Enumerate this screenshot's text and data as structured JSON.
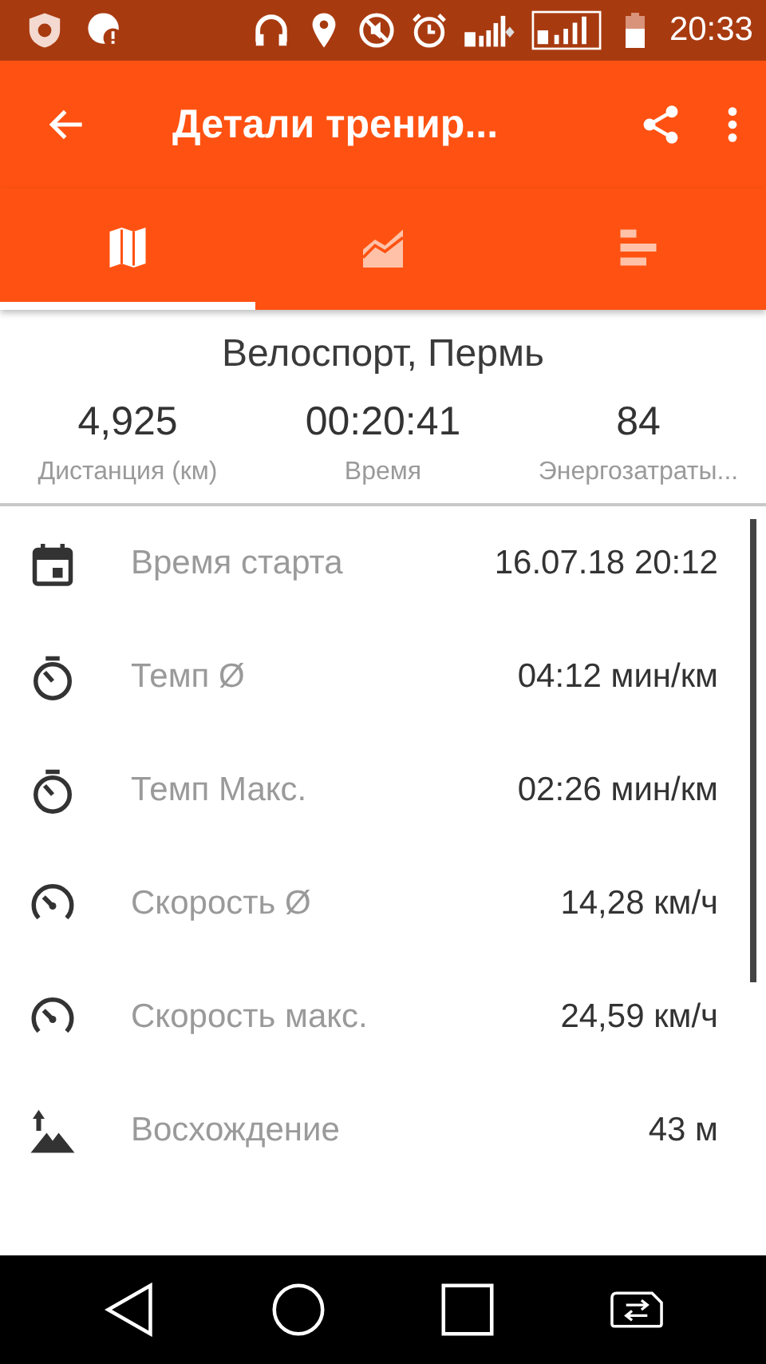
{
  "status_bar": {
    "time": "20:33"
  },
  "app_bar": {
    "title": "Детали тренир..."
  },
  "tabs": [
    {
      "kind": "map",
      "selected": true
    },
    {
      "kind": "chart",
      "selected": false
    },
    {
      "kind": "bars",
      "selected": false
    }
  ],
  "summary": {
    "title": "Велоспорт, Пермь",
    "stats": [
      {
        "value": "4,925",
        "label": "Дистанция (км)"
      },
      {
        "value": "00:20:41",
        "label": "Время"
      },
      {
        "value": "84",
        "label": "Энергозатраты..."
      }
    ]
  },
  "details": [
    {
      "kind": "calendar",
      "label": "Время старта",
      "value": "16.07.18 20:12"
    },
    {
      "kind": "timer",
      "label": "Темп Ø",
      "value": "04:12 мин/км"
    },
    {
      "kind": "timer",
      "label": "Темп Макс.",
      "value": "02:26 мин/км"
    },
    {
      "kind": "speed",
      "label": "Скорость Ø",
      "value": "14,28 км/ч"
    },
    {
      "kind": "speed",
      "label": "Скорость макс.",
      "value": "24,59 км/ч"
    },
    {
      "kind": "ascent",
      "label": "Восхождение",
      "value": "43 м"
    }
  ]
}
